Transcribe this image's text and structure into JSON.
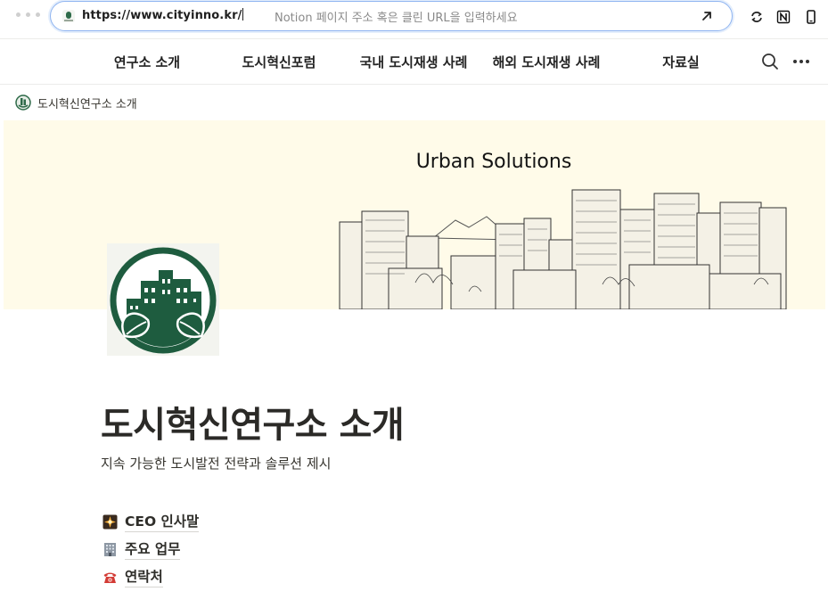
{
  "browser": {
    "url": "https://www.cityinno.kr/",
    "placeholder": "Notion 페이지 주소 혹은 클린 URL을 입력하세요",
    "icons": [
      "favicon",
      "open-arrow-icon",
      "sync-icon",
      "notion-icon",
      "mobile-icon"
    ]
  },
  "nav": {
    "items": [
      {
        "label": "연구소 소개"
      },
      {
        "label": "도시혁신포럼"
      },
      {
        "label": "국내 도시재생 사례"
      },
      {
        "label": "해외 도시재생 사례"
      },
      {
        "label": "자료실"
      }
    ],
    "icons": [
      "search-icon",
      "more-icon"
    ]
  },
  "breadcrumb": {
    "label": "도시혁신연구소 소개"
  },
  "cover": {
    "title": "Urban Solutions"
  },
  "page": {
    "title": "도시혁신연구소 소개",
    "subtitle": "지속 가능한 도시발전 전략과 솔루션 제시",
    "links": [
      {
        "label": "CEO 인사말",
        "icon": "sparkle-icon"
      },
      {
        "label": "주요 업무",
        "icon": "office-building-icon"
      },
      {
        "label": "연락처",
        "icon": "telephone-icon"
      }
    ]
  },
  "colors": {
    "brand_green": "#1e5c3f",
    "cover_bg": "#fffbe9",
    "url_focus": "#8fb4f0"
  }
}
